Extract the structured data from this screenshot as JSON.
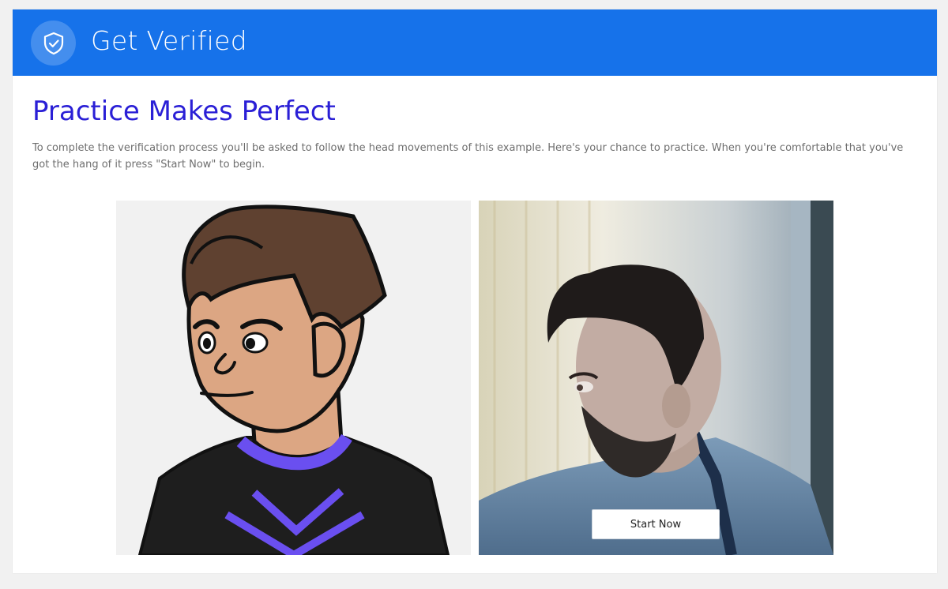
{
  "header": {
    "title": "Get Verified",
    "icon": "shield-check-icon",
    "color": "#1672ea"
  },
  "main": {
    "heading": "Practice Makes Perfect",
    "heading_color": "#2a1fd6",
    "description": "To complete the verification process you'll be asked to follow the head movements of this example. Here's your chance to practice. When you're comfortable that you've got the hang of it press \"Start Now\" to begin."
  },
  "panels": {
    "example": "cartoon-avatar",
    "camera": "webcam-feed",
    "start_button_label": "Start Now"
  }
}
